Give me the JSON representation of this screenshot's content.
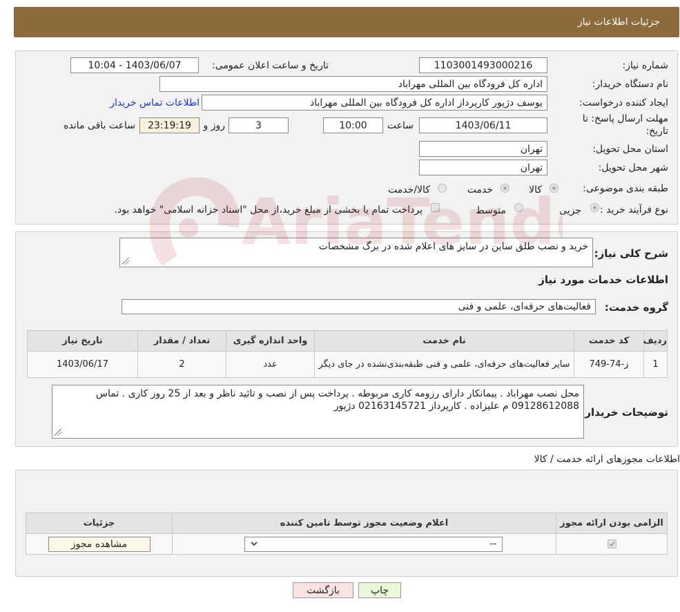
{
  "header": {
    "title": "جزئیات اطلاعات نیاز"
  },
  "form": {
    "need_number_label": "شماره نیاز:",
    "need_number": "1103001493000216",
    "announce_label": "تاریخ و ساعت اعلان عمومی:",
    "announce_value": "1403/06/07 - 10:04",
    "buyer_org_label": "نام دستگاه خریدار:",
    "buyer_org": "اداره کل فرودگاه بین المللی مهراباد",
    "creator_label": "ایجاد کننده درخواست:",
    "creator": "یوسف دژپور کارپرداز اداره کل فرودگاه بین المللی مهراباد",
    "contact_link": "اطلاعات تماس خریدار",
    "deadline_label": "مهلت ارسال پاسخ: تا تاریخ:",
    "deadline_date": "1403/06/11",
    "time_label": "ساعت",
    "deadline_time": "10:00",
    "days_value": "3",
    "days_label": "روز و",
    "remaining_time": "23:19:19",
    "remaining_label": "ساعت باقی مانده",
    "province_label": "استان محل تحویل:",
    "province": "تهران",
    "city_label": "شهر محل تحویل:",
    "city": "تهران",
    "category_label": "طبقه بندی موضوعی:",
    "category_options": [
      "کالا",
      "خدمت",
      "کالا/خدمت"
    ],
    "process_label": "نوع فرآیند خرید :",
    "process_options": [
      "جزیی",
      "متوسط"
    ],
    "payment_note": "پرداخت تمام یا بخشی از مبلغ خرید،از محل \"اسناد خزانه اسلامی\" خواهد بود."
  },
  "summary": {
    "label": "شرح کلی نیاز:",
    "text": "خرید و نصب طلق ساین در سایز های اعلام شده در برگ مشخصات"
  },
  "services": {
    "section_title": "اطلاعات خدمات مورد نیاز",
    "group_label": "گروه خدمت:",
    "group_value": "فعالیت‌های حرفه‌ای، علمی و فنی",
    "columns": [
      "ردیف",
      "کد خدمت",
      "نام خدمت",
      "واحد اندازه گیری",
      "تعداد / مقدار",
      "تاریخ نیاز"
    ],
    "rows": [
      {
        "row": "1",
        "code": "ز-74-749",
        "name": "سایر فعالیت‌های حرفه‌ای، علمی و فنی طبقه‌بندی‌نشده در جای دیگر",
        "unit": "عدد",
        "qty": "2",
        "date": "1403/06/17"
      }
    ]
  },
  "buyer_notes": {
    "label": "توضیحات خریدار:",
    "text": "محل نصب مهراباد . پیمانکار دارای رزومه کاری مربوطه . پرداخت پس از نصب و تائید ناظر و بعد از 25 روز کاری . تماس 09128612088 م علیزاده . کارپرداز 02163145721 دژپور"
  },
  "permits": {
    "title": "اطلاعات مجوزهای ارائه خدمت / کالا",
    "columns": [
      "الزامی بودن ارائه مجوز",
      "اعلام وضعیت مجوز توسط تامین کننده",
      "جزئیات"
    ],
    "select_value": "--",
    "view_button": "مشاهده مجوز"
  },
  "footer": {
    "print_button": "چاپ",
    "back_button": "بازگشت"
  },
  "watermark": {
    "text": "AriaTender.neT"
  },
  "colors": {
    "header_bg": "#8c6a3c",
    "link": "#1a33cc",
    "print_bg": "#eaf7d8",
    "back_bg": "#fbe3e3"
  }
}
